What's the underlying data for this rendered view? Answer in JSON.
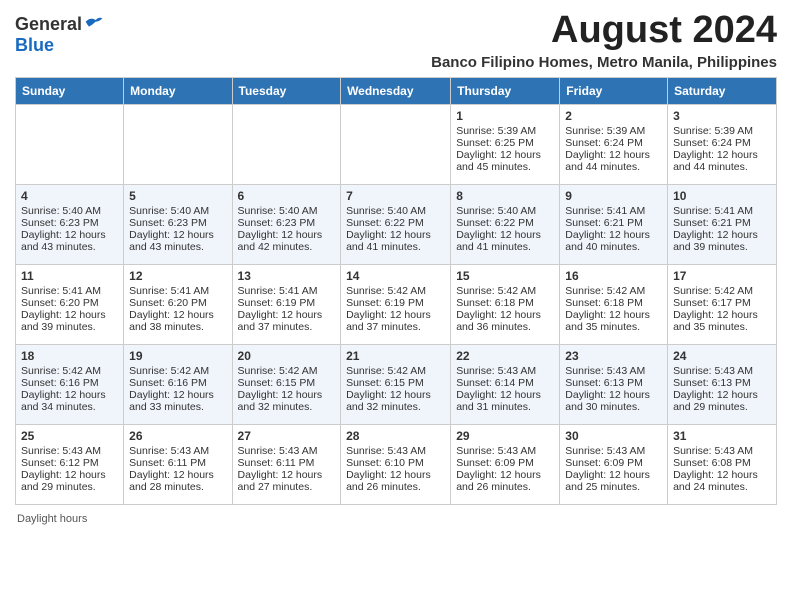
{
  "header": {
    "logo_general": "General",
    "logo_blue": "Blue",
    "title": "August 2024",
    "subtitle": "Banco Filipino Homes, Metro Manila, Philippines"
  },
  "calendar": {
    "days_of_week": [
      "Sunday",
      "Monday",
      "Tuesday",
      "Wednesday",
      "Thursday",
      "Friday",
      "Saturday"
    ],
    "weeks": [
      [
        {
          "day": "",
          "content": ""
        },
        {
          "day": "",
          "content": ""
        },
        {
          "day": "",
          "content": ""
        },
        {
          "day": "",
          "content": ""
        },
        {
          "day": "1",
          "content": "Sunrise: 5:39 AM\nSunset: 6:25 PM\nDaylight: 12 hours\nand 45 minutes."
        },
        {
          "day": "2",
          "content": "Sunrise: 5:39 AM\nSunset: 6:24 PM\nDaylight: 12 hours\nand 44 minutes."
        },
        {
          "day": "3",
          "content": "Sunrise: 5:39 AM\nSunset: 6:24 PM\nDaylight: 12 hours\nand 44 minutes."
        }
      ],
      [
        {
          "day": "4",
          "content": "Sunrise: 5:40 AM\nSunset: 6:23 PM\nDaylight: 12 hours\nand 43 minutes."
        },
        {
          "day": "5",
          "content": "Sunrise: 5:40 AM\nSunset: 6:23 PM\nDaylight: 12 hours\nand 43 minutes."
        },
        {
          "day": "6",
          "content": "Sunrise: 5:40 AM\nSunset: 6:23 PM\nDaylight: 12 hours\nand 42 minutes."
        },
        {
          "day": "7",
          "content": "Sunrise: 5:40 AM\nSunset: 6:22 PM\nDaylight: 12 hours\nand 41 minutes."
        },
        {
          "day": "8",
          "content": "Sunrise: 5:40 AM\nSunset: 6:22 PM\nDaylight: 12 hours\nand 41 minutes."
        },
        {
          "day": "9",
          "content": "Sunrise: 5:41 AM\nSunset: 6:21 PM\nDaylight: 12 hours\nand 40 minutes."
        },
        {
          "day": "10",
          "content": "Sunrise: 5:41 AM\nSunset: 6:21 PM\nDaylight: 12 hours\nand 39 minutes."
        }
      ],
      [
        {
          "day": "11",
          "content": "Sunrise: 5:41 AM\nSunset: 6:20 PM\nDaylight: 12 hours\nand 39 minutes."
        },
        {
          "day": "12",
          "content": "Sunrise: 5:41 AM\nSunset: 6:20 PM\nDaylight: 12 hours\nand 38 minutes."
        },
        {
          "day": "13",
          "content": "Sunrise: 5:41 AM\nSunset: 6:19 PM\nDaylight: 12 hours\nand 37 minutes."
        },
        {
          "day": "14",
          "content": "Sunrise: 5:42 AM\nSunset: 6:19 PM\nDaylight: 12 hours\nand 37 minutes."
        },
        {
          "day": "15",
          "content": "Sunrise: 5:42 AM\nSunset: 6:18 PM\nDaylight: 12 hours\nand 36 minutes."
        },
        {
          "day": "16",
          "content": "Sunrise: 5:42 AM\nSunset: 6:18 PM\nDaylight: 12 hours\nand 35 minutes."
        },
        {
          "day": "17",
          "content": "Sunrise: 5:42 AM\nSunset: 6:17 PM\nDaylight: 12 hours\nand 35 minutes."
        }
      ],
      [
        {
          "day": "18",
          "content": "Sunrise: 5:42 AM\nSunset: 6:16 PM\nDaylight: 12 hours\nand 34 minutes."
        },
        {
          "day": "19",
          "content": "Sunrise: 5:42 AM\nSunset: 6:16 PM\nDaylight: 12 hours\nand 33 minutes."
        },
        {
          "day": "20",
          "content": "Sunrise: 5:42 AM\nSunset: 6:15 PM\nDaylight: 12 hours\nand 32 minutes."
        },
        {
          "day": "21",
          "content": "Sunrise: 5:42 AM\nSunset: 6:15 PM\nDaylight: 12 hours\nand 32 minutes."
        },
        {
          "day": "22",
          "content": "Sunrise: 5:43 AM\nSunset: 6:14 PM\nDaylight: 12 hours\nand 31 minutes."
        },
        {
          "day": "23",
          "content": "Sunrise: 5:43 AM\nSunset: 6:13 PM\nDaylight: 12 hours\nand 30 minutes."
        },
        {
          "day": "24",
          "content": "Sunrise: 5:43 AM\nSunset: 6:13 PM\nDaylight: 12 hours\nand 29 minutes."
        }
      ],
      [
        {
          "day": "25",
          "content": "Sunrise: 5:43 AM\nSunset: 6:12 PM\nDaylight: 12 hours\nand 29 minutes."
        },
        {
          "day": "26",
          "content": "Sunrise: 5:43 AM\nSunset: 6:11 PM\nDaylight: 12 hours\nand 28 minutes."
        },
        {
          "day": "27",
          "content": "Sunrise: 5:43 AM\nSunset: 6:11 PM\nDaylight: 12 hours\nand 27 minutes."
        },
        {
          "day": "28",
          "content": "Sunrise: 5:43 AM\nSunset: 6:10 PM\nDaylight: 12 hours\nand 26 minutes."
        },
        {
          "day": "29",
          "content": "Sunrise: 5:43 AM\nSunset: 6:09 PM\nDaylight: 12 hours\nand 26 minutes."
        },
        {
          "day": "30",
          "content": "Sunrise: 5:43 AM\nSunset: 6:09 PM\nDaylight: 12 hours\nand 25 minutes."
        },
        {
          "day": "31",
          "content": "Sunrise: 5:43 AM\nSunset: 6:08 PM\nDaylight: 12 hours\nand 24 minutes."
        }
      ]
    ]
  },
  "footer": {
    "daylight_label": "Daylight hours"
  }
}
